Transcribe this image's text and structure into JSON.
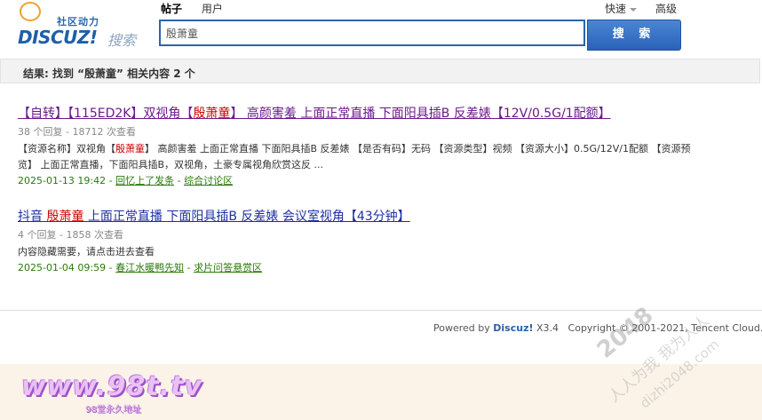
{
  "header": {
    "logo_tag": "社区动力",
    "logo_brand": "DISCUZ!",
    "logo_sub": "搜索",
    "search_types": [
      "帖子",
      "用户"
    ],
    "quick_label": "快速",
    "advanced_label": "高级",
    "search_value": "殷萧童",
    "search_button": "搜 索"
  },
  "result_summary": "结果: 找到 “殷萧童” 相关内容 2 个",
  "results": [
    {
      "title_pre": "【自转】【115ED2K】双视角【",
      "title_kw": "殷萧童",
      "title_post": "】 高颜害羞 上面正常直播 下面阳具插B 反差婊【12V/0.5G/1配额】",
      "meta": "38 个回复 - 18712 次查看",
      "excerpt_pre": "【资源名称】双视角【",
      "excerpt_kw": "殷萧童",
      "excerpt_post": "】 高颜害羞 上面正常直播 下面阳具插B 反差婊 【是否有码】无码 【资源类型】视频 【资源大小】0.5G/12V/1配额 【资源预览】 上面正常直播，下面阳具插B，双视角，土豪专属视角欣赏这反 ...",
      "date": "2025-01-13 19:42",
      "author": "回忆上了发条",
      "forum": "综合讨论区"
    },
    {
      "title_pre": "抖音 ",
      "title_kw": "殷萧童",
      "title_post": " 上面正常直播 下面阳具插B 反差婊 会议室视角【43分钟】",
      "meta": "4 个回复 - 1858 次查看",
      "excerpt_pre": "内容隐藏需要，请点击进去查看",
      "excerpt_kw": "",
      "excerpt_post": "",
      "date": "2025-01-04 09:59",
      "author": "春江水暖鸭先知",
      "forum": "求片问答悬赏区"
    }
  ],
  "footer": {
    "powered_by": "Powered by",
    "product": "Discuz!",
    "version": "X3.4",
    "copyright": "Copyright © 2001-2021, Tencent Cloud."
  },
  "watermarks": {
    "site_logo": "www.98t.tv",
    "site_logo_sub": "98堂永久地址",
    "diag_num": "2048",
    "diag_line1": "人人为我 我为人人",
    "diag_line2": "dizhi2048.com"
  },
  "colors": {
    "accent": "#2e63b0",
    "keyword": "#d00000",
    "visited_title": "#6b1a8a",
    "title": "#1e2fa0",
    "info_green": "#2b7a0b"
  }
}
